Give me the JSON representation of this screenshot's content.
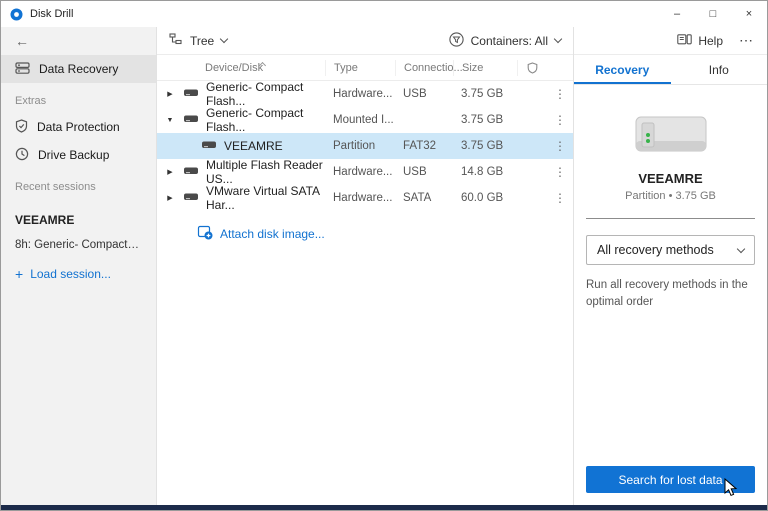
{
  "colors": {
    "accent": "#1173d4",
    "selection": "#cde7f8",
    "bottom_edge": "#1c2b4a"
  },
  "window": {
    "title": "Disk Drill",
    "minimize": "–",
    "maximize": "□",
    "close": "×"
  },
  "sidebar": {
    "back": "←",
    "data_recovery": "Data Recovery",
    "extras_label": "Extras",
    "data_protection": "Data Protection",
    "drive_backup": "Drive Backup",
    "recent_label": "Recent sessions",
    "session_name": "VEEAMRE",
    "session_item": "8h: Generic- Compact Flas...",
    "load_session": "Load session...",
    "plus": "+"
  },
  "toolbar": {
    "view": "Tree",
    "containers": "Containers: All",
    "help": "Help",
    "more": "⋯"
  },
  "table": {
    "headers": {
      "device": "Device/Disk",
      "type": "Type",
      "connection": "Connectio...",
      "size": "Size"
    },
    "sort_indicator": "⌃",
    "rows": [
      {
        "expander": "▶",
        "name": "Generic- Compact Flash...",
        "type": "Hardware...",
        "connection": "USB",
        "size": "3.75 GB",
        "menu": "⋮"
      },
      {
        "expander": "▼",
        "name": "Generic- Compact Flash...",
        "type": "Mounted I...",
        "connection": "",
        "size": "3.75 GB",
        "menu": "⋮"
      },
      {
        "expander": "",
        "name": "VEEAMRE",
        "type": "Partition",
        "connection": "FAT32",
        "size": "3.75 GB",
        "menu": "⋮"
      },
      {
        "expander": "▶",
        "name": "Multiple Flash Reader US...",
        "type": "Hardware...",
        "connection": "USB",
        "size": "14.8 GB",
        "menu": "⋮"
      },
      {
        "expander": "▶",
        "name": "VMware Virtual SATA Har...",
        "type": "Hardware...",
        "connection": "SATA",
        "size": "60.0 GB",
        "menu": "⋮"
      }
    ],
    "attach": "Attach disk image..."
  },
  "panel": {
    "tab_recovery": "Recovery",
    "tab_info": "Info",
    "device_name": "VEEAMRE",
    "device_meta": "Partition • 3.75 GB",
    "method": "All recovery methods",
    "method_desc": "Run all recovery methods in the optimal order",
    "search": "Search for lost data"
  }
}
